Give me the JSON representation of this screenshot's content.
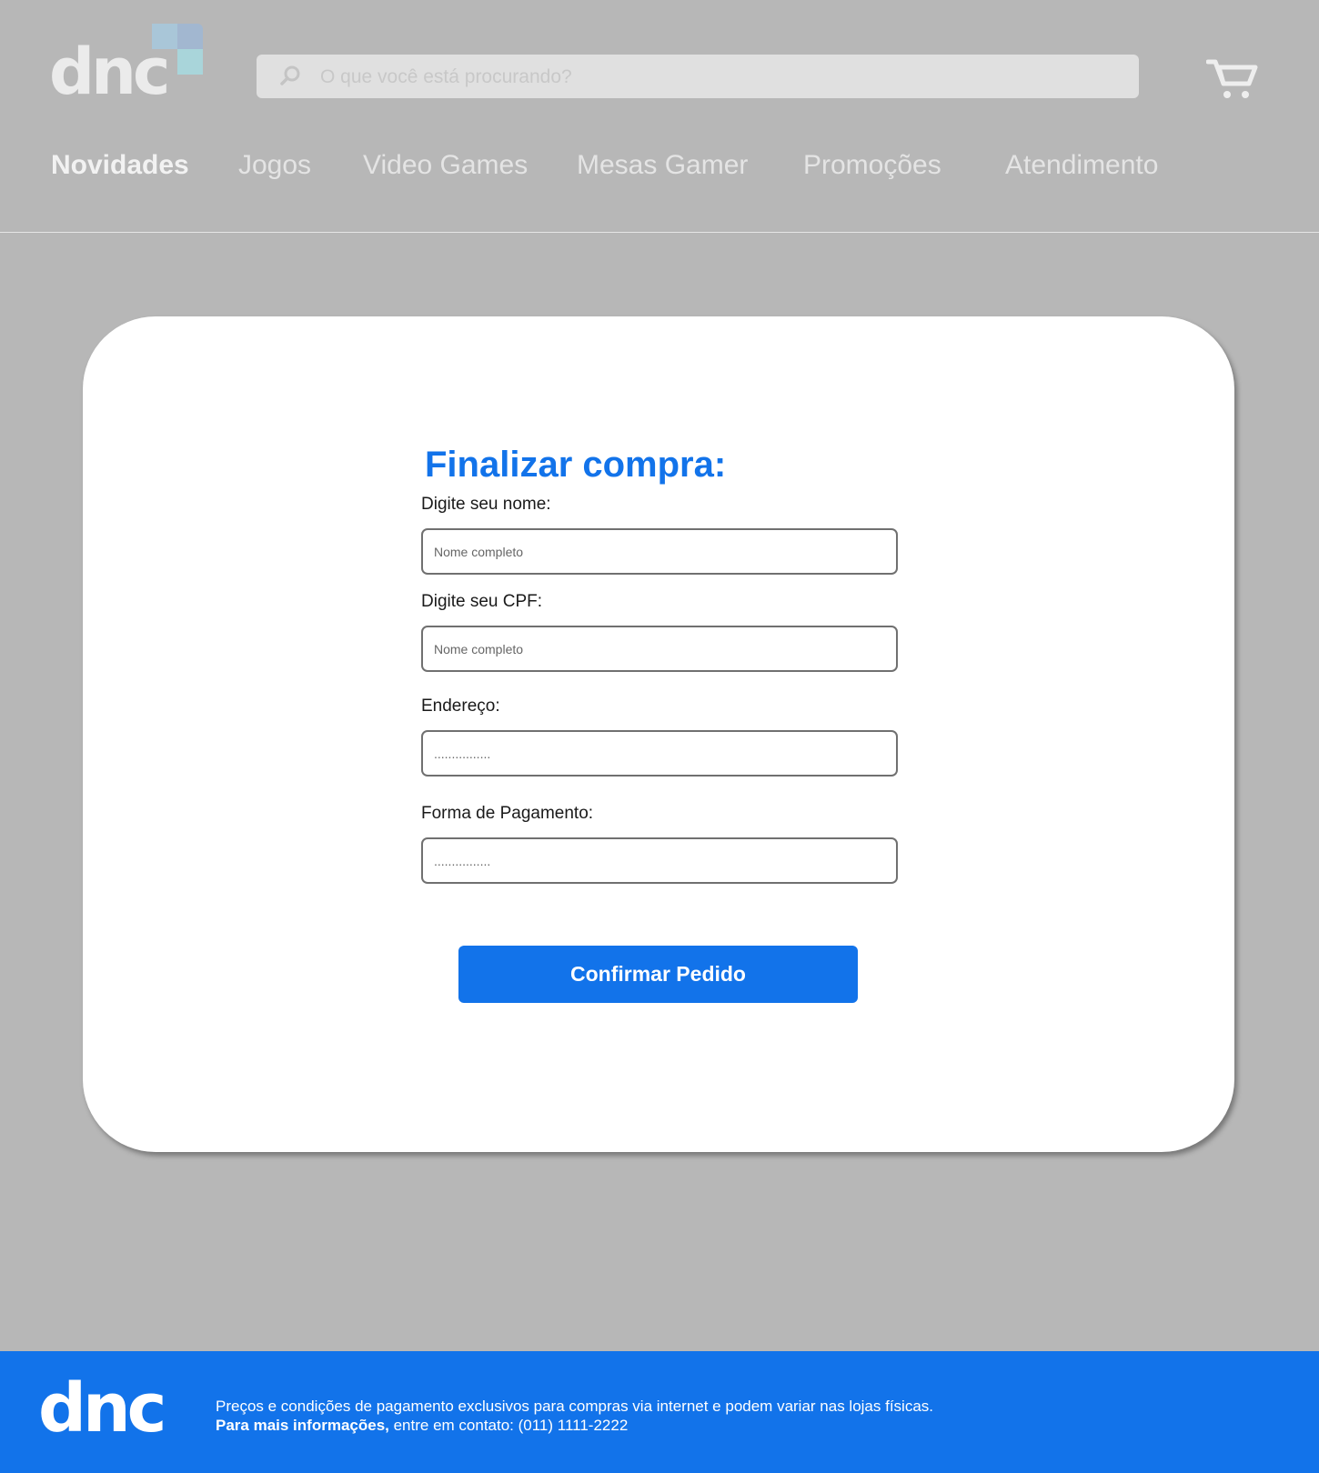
{
  "header": {
    "logo_text": "dnc",
    "search": {
      "placeholder": "O que você está procurando?"
    },
    "nav": [
      {
        "label": "Novidades",
        "active": true
      },
      {
        "label": "Jogos"
      },
      {
        "label": "Video Games"
      },
      {
        "label": "Mesas Gamer"
      },
      {
        "label": "Promoções"
      },
      {
        "label": "Atendimento"
      }
    ]
  },
  "form": {
    "title": "Finalizar compra:",
    "fields": [
      {
        "label": "Digite seu nome:",
        "placeholder": "Nome completo"
      },
      {
        "label": "Digite seu CPF:",
        "placeholder": "Nome completo"
      },
      {
        "label": "Endereço:",
        "placeholder": "................"
      },
      {
        "label": "Forma de Pagamento:",
        "placeholder": "................"
      }
    ],
    "submit_label": "Confirmar Pedido"
  },
  "footer": {
    "logo_text": "dnc",
    "line1": "Preços e condições de pagamento exclusivos para compras via internet e podem variar nas lojas físicas.",
    "line2_bold": "Para mais informações,",
    "line2_rest": " entre em contato: (011) 1111-2222"
  },
  "colors": {
    "accent": "#1273ea",
    "page_background": "#b7b7b7",
    "card_background": "#ffffff"
  },
  "icons": [
    "search-icon",
    "cart-icon"
  ]
}
